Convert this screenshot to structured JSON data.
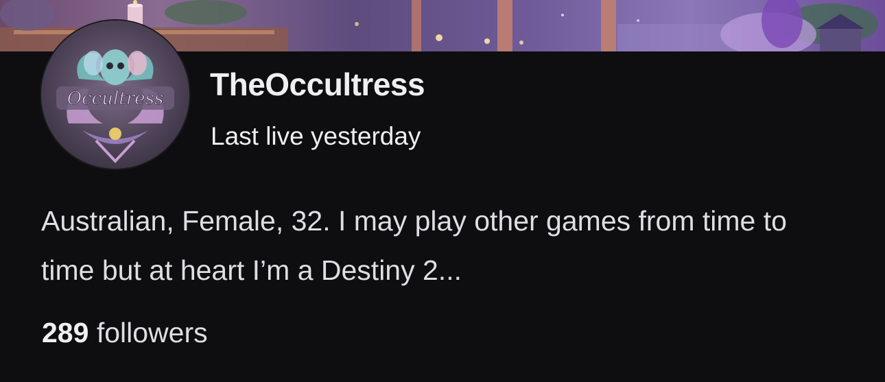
{
  "banner": {
    "icon": "banner-image"
  },
  "profile": {
    "avatar_text": "Occultress",
    "channel_name": "TheOccultress",
    "status": "Last live yesterday",
    "bio": "Australian, Female, 32. I may play other games from time to time but at heart I’m a Destiny 2...",
    "followers_count": "289",
    "followers_label": "followers"
  },
  "colors": {
    "background": "#0e0e10",
    "text": "#efeff1",
    "accent_purple": "#8b78b8"
  }
}
